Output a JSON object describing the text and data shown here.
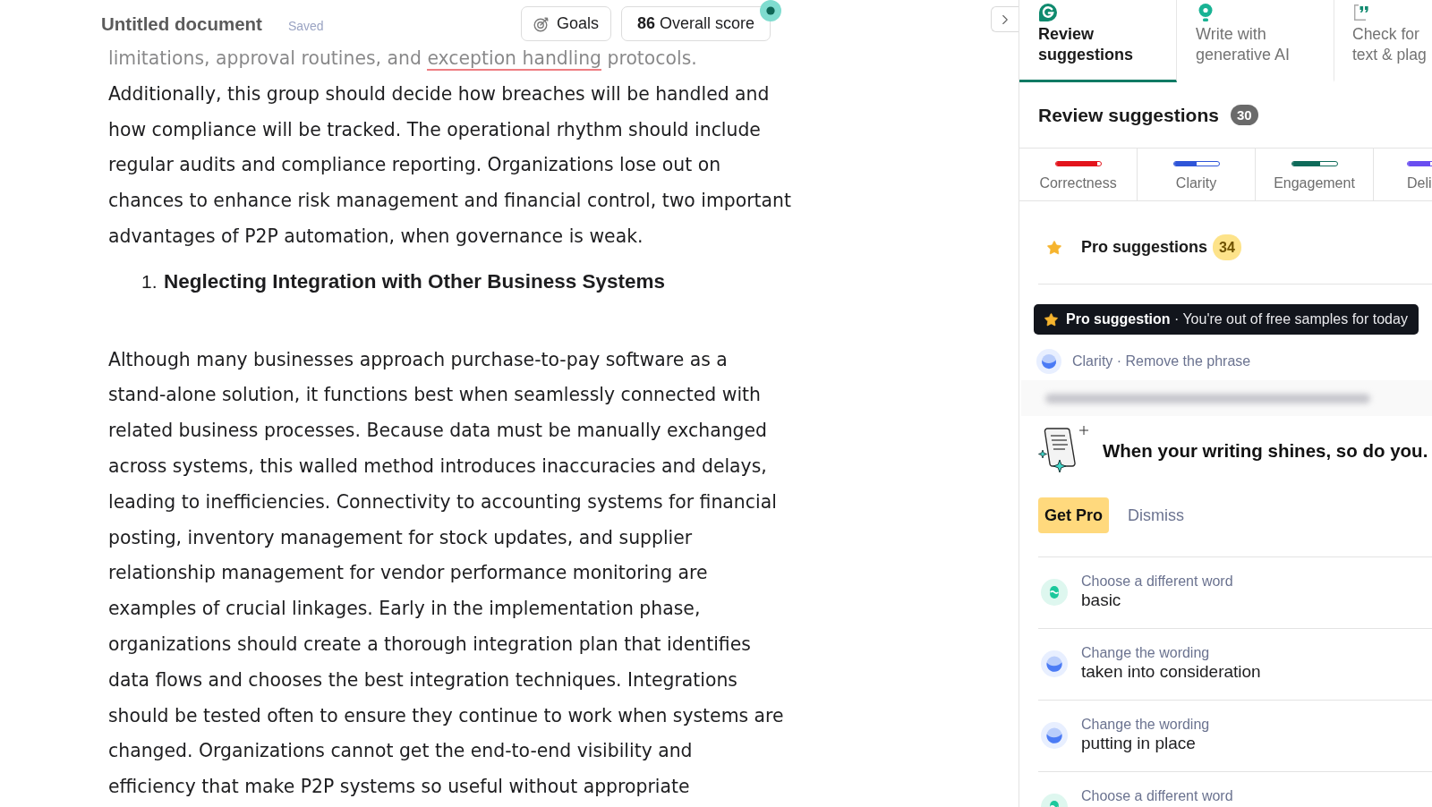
{
  "header": {
    "title": "Untitled document",
    "status": "Saved",
    "goals_button": "Goals",
    "score_button": "**86** Overall score"
  },
  "document": {
    "blocks": [
      {
        "kind": "paragraph",
        "segments": [
          {
            "text": "limitations, approval routines, and ",
            "flagged": false
          },
          {
            "text": "exception handling",
            "flagged": true
          },
          {
            "text": " protocols.\nAdditionally, this group should decide how breaches will be handled and\nhow compliance will be tracked. The operational rhythm should include\nregular audits and compliance reporting. Organizations lose out on\nchances to enhance risk management and financial control, two important\nadvantages of P2P automation, when governance is weak.",
            "flagged": false
          }
        ]
      },
      {
        "kind": "heading",
        "number": "1.",
        "text": "Neglecting Integration with Other Business Systems"
      },
      {
        "kind": "paragraph",
        "segments": [
          {
            "text": "Although many businesses approach purchase-to-pay software as a\nstand-alone solution, it functions best when seamlessly connected with\nrelated business processes. Because data must be manually exchanged\nacross systems, this walled method introduces inaccuracies and delays,\nleading to inefficiencies. Connectivity to accounting systems for financial\nposting, inventory management for stock updates, and supplier\nrelationship management for vendor performance monitoring are\nexamples of crucial linkages. Early in the implementation phase,\norganizations should create a thorough integration plan that identifies\ndata flows and chooses the best integration techniques. Integrations\nshould be tested often to ensure they continue to work when systems are\nchanged. Organizations cannot get the end-to-end visibility and\nefficiency that make P2P systems so useful without appropriate",
            "flagged": false
          }
        ]
      }
    ]
  },
  "panel": {
    "tabs": [
      {
        "kind": "logo",
        "label": "Review\nsuggestions",
        "selected": true
      },
      {
        "kind": "bulb",
        "label": "Write with\ngenerative AI",
        "selected": false
      },
      {
        "kind": "quote",
        "label": "Check for\ntext & plag",
        "selected": false
      }
    ],
    "heading": "Review suggestions",
    "count": "30",
    "categories": [
      {
        "label": "Correctness",
        "color": "#e3141c",
        "level": 0.92
      },
      {
        "label": "Clarity",
        "color": "#2f55d8",
        "level": 0.5
      },
      {
        "label": "Engagement",
        "color": "#0f6b5a",
        "level": 0.62
      },
      {
        "label": "Deli",
        "color": "#6a4ef0",
        "level": 0.5
      }
    ],
    "pro": {
      "label": "Pro suggestions",
      "count": "34"
    },
    "pro_card": {
      "banner": "**Pro suggestion** · You're out of free samples for today",
      "category": {
        "kind": "clarity",
        "text": "Clarity · Remove the phrase"
      },
      "promo": "When your writing shines, so do you.",
      "primary_button": "Get Pro",
      "secondary_button": "Dismiss"
    },
    "suggestions": [
      {
        "kind": "engagement",
        "title": "Choose a different word",
        "value": "basic"
      },
      {
        "kind": "clarity",
        "title": "Change the wording",
        "value": "taken into consideration"
      },
      {
        "kind": "clarity",
        "title": "Change the wording",
        "value": "putting in place"
      },
      {
        "kind": "engagement",
        "title": "Choose a different word"
      }
    ]
  }
}
